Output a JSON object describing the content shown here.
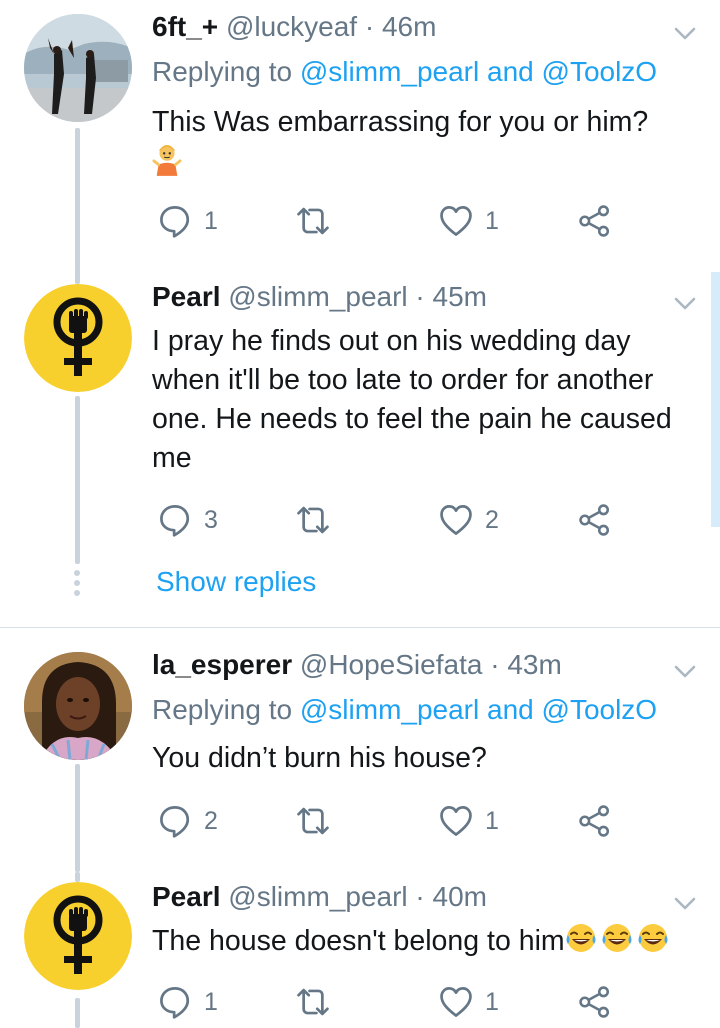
{
  "tweets": [
    {
      "name": "6ft_+",
      "handle": "@luckyeaf",
      "time": "46m",
      "reply_prefix": "Replying to",
      "reply_user1": "@slimm_pearl",
      "reply_and": "and",
      "reply_user2": "@ToolzO",
      "text": "This Was embarrassing for you or him?",
      "reply_count": "1",
      "like_count": "1"
    },
    {
      "name": "Pearl",
      "handle": "@slimm_pearl",
      "time": "45m",
      "text": "I pray he finds out on his wedding day when it'll be too late to order for another one. He needs to feel the pain he caused me",
      "reply_count": "3",
      "like_count": "2"
    },
    {
      "name": "la_esperer",
      "handle": "@HopeSiefata",
      "time": "43m",
      "reply_prefix": "Replying to",
      "reply_user1": "@slimm_pearl",
      "reply_and": "and",
      "reply_user2": "@ToolzO",
      "text": "You didn’t burn his house?",
      "reply_count": "2",
      "like_count": "1"
    },
    {
      "name": "Pearl",
      "handle": "@slimm_pearl",
      "time": "40m",
      "text": "The house doesn't belong to him",
      "reply_count": "1",
      "like_count": "1"
    }
  ],
  "show_replies": "Show replies",
  "separator": "·",
  "colors": {
    "link": "#1da1f2",
    "muted": "#657786",
    "thread_line": "#c9d3dc",
    "avatar_yellow": "#f8d02e"
  },
  "icons": {
    "reply": "reply-icon",
    "retweet": "retweet-icon",
    "like": "heart-icon",
    "share": "share-icon",
    "chevron": "chevron-down-icon",
    "shrug": "person-shrugging-emoji",
    "laugh": "tears-of-joy-emoji"
  }
}
